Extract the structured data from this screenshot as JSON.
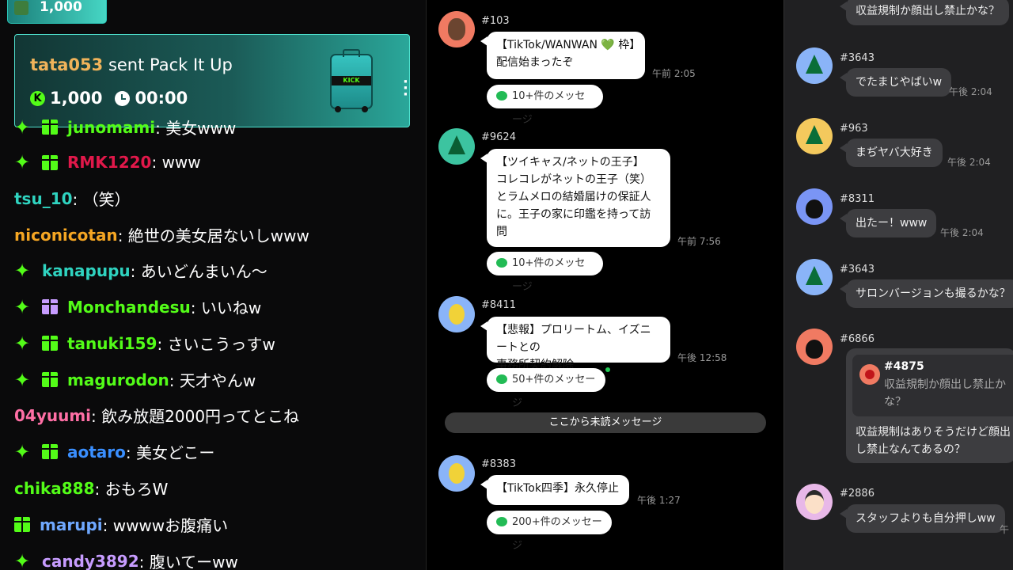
{
  "left_chat": {
    "top_chip_amount": "1,000",
    "gift_alert": {
      "user": "tata053",
      "action": " sent Pack It Up",
      "kicks_icon": "K",
      "kicks": "1,000",
      "timer": "00:00",
      "item_label": "KICK"
    },
    "messages": [
      {
        "name": "junomami",
        "text": ": 美女www",
        "color": "#53fc18",
        "star": true,
        "gift": "green"
      },
      {
        "name": "RMK1220",
        "text": ": www",
        "color": "#e1184a",
        "star": true,
        "gift": "green"
      },
      {
        "name": "tsu_10",
        "text": ": （笑）",
        "color": "#2fd3c0",
        "star": false,
        "gift": ""
      },
      {
        "name": "niconicotan",
        "text": ": 絶世の美女居ないしwww",
        "color": "#f5a623",
        "star": false,
        "gift": ""
      },
      {
        "name": "kanapupu",
        "text": ": あいどんまいん〜",
        "color": "#2fd3c0",
        "star": true,
        "gift": ""
      },
      {
        "name": "Monchandesu",
        "text": ": いいねw",
        "color": "#53fc18",
        "star": true,
        "gift": "purple"
      },
      {
        "name": "tanuki159",
        "text": ": さいこうっすw",
        "color": "#53fc18",
        "star": true,
        "gift": "green"
      },
      {
        "name": "magurodon",
        "text": ": 天才やんw",
        "color": "#53fc18",
        "star": true,
        "gift": "green"
      },
      {
        "name": "04yuumi",
        "text": ": 飲み放題2000円ってとこね",
        "color": "#ff6fa5",
        "star": false,
        "gift": ""
      },
      {
        "name": "aotaro",
        "text": ": 美女どこー",
        "color": "#3a8fff",
        "star": true,
        "gift": "green"
      },
      {
        "name": "chika888",
        "text": ": おもろW",
        "color": "#53fc18",
        "star": false,
        "gift": ""
      },
      {
        "name": "marupi",
        "text": ": wwwwお腹痛い",
        "color": "#6fa8ff",
        "star": false,
        "gift": "green"
      },
      {
        "name": "candy3892",
        "text": ": 腹いてーww",
        "color": "#c79cff",
        "star": true,
        "gift": ""
      }
    ]
  },
  "middle_chat": {
    "posts": [
      {
        "avatar": "face",
        "number": "#103",
        "lines": [
          "【TikTok/WANWAN 💚 枠】",
          "配信始まったぞ"
        ],
        "time": "午前 2:05",
        "more": "10+件のメッセージ"
      },
      {
        "avatar": "tree",
        "number": "#9624",
        "lines": [
          "【ツイキャス/ネットの王子】",
          "コレコレがネットの王子（笑）",
          "とラムメロの結婚届けの保証人",
          "に。王子の家に印鑑を持って訪",
          "問"
        ],
        "time": "午前 7:56",
        "more": "10+件のメッセージ"
      },
      {
        "avatar": "lemon",
        "number": "#8411",
        "lines": [
          "【悲報】プロリートム、イズニートとの",
          "事務所契約解除"
        ],
        "time": "午後 12:58",
        "more": "50+件のメッセージ"
      },
      {
        "avatar": "lemon",
        "number": "#8383",
        "lines": [
          "【TikTok四季】永久停止"
        ],
        "time": "午後 1:27",
        "more": "200+件のメッセージ"
      }
    ],
    "unread_divider": "ここから未読メッセージ"
  },
  "right_chat": {
    "top_partial": "収益規制か顔出し禁止かな？",
    "posts": [
      {
        "avatar": "tree",
        "number": "#3643",
        "text": "でたまじやばいw",
        "time": "午後 2:04"
      },
      {
        "avatar": "yel",
        "number": "#963",
        "text": "まぢヤバ大好き",
        "time": "午後 2:04"
      },
      {
        "avatar": "cat",
        "number": "#8311",
        "text": "出たー！www",
        "time": "午後 2:04"
      },
      {
        "avatar": "tree",
        "number": "#3643",
        "text": "サロンバージョンも撮るかな？",
        "time": ""
      }
    ],
    "reply_post": {
      "number": "#6866",
      "quoted_number": "#4875",
      "quoted_text": "収益規制か顔出し禁止かな？",
      "reply_text": "収益規制はありそうだけど顔出し禁止なんてあるの？"
    },
    "last_post": {
      "number": "#2886",
      "text": "スタッフよりも自分押しww",
      "time": "午"
    }
  }
}
